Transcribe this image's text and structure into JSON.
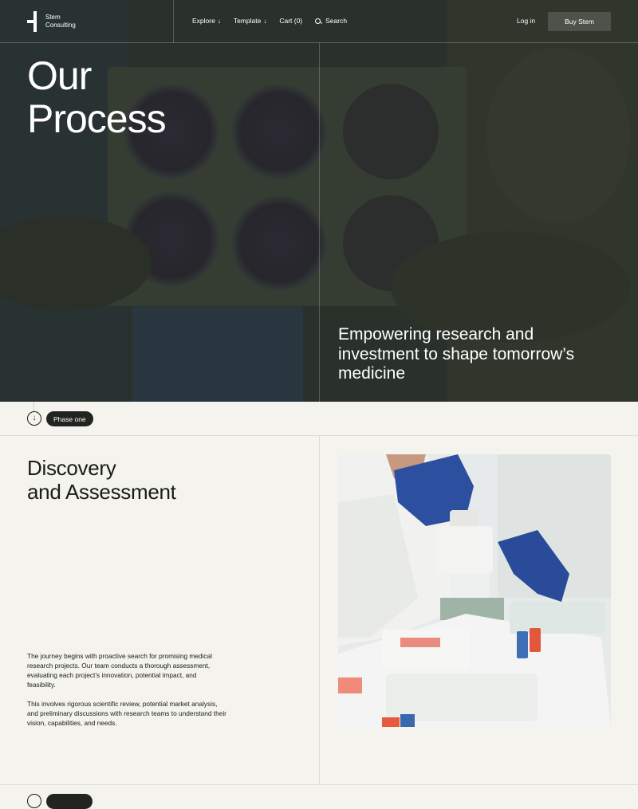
{
  "brand": {
    "line1": "Stem",
    "line2": "Consulting"
  },
  "nav": {
    "explore": "Explore",
    "template": "Template",
    "cart": "Cart (0)",
    "search": "Search",
    "login": "Log in",
    "buy": "Buy Stem",
    "arrow": "↓"
  },
  "hero": {
    "title_line1": "Our",
    "title_line2": "Process",
    "subtitle": "Empowering research and investment to shape tomorrow’s medicine"
  },
  "phase": {
    "icon": "arrow-down-circle-icon",
    "arrow": "↓",
    "label": "Phase one"
  },
  "section": {
    "title_line1": "Discovery",
    "title_line2": "and Assessment",
    "paragraph1": "The journey begins with proactive search for promising medical research projects. Our team conducts a thorough assessment, evaluating each project’s innovation, potential impact, and feasibility.",
    "paragraph2": "This involves rigorous scientific review, potential market analysis, and preliminary discussions with research teams to understand their vision, capabilities, and needs."
  },
  "colors": {
    "background": "#f4f3ee",
    "hero_dark": "#2c3530",
    "pill": "#21241f",
    "button": "#4d524b",
    "text": "#1a1c17"
  }
}
